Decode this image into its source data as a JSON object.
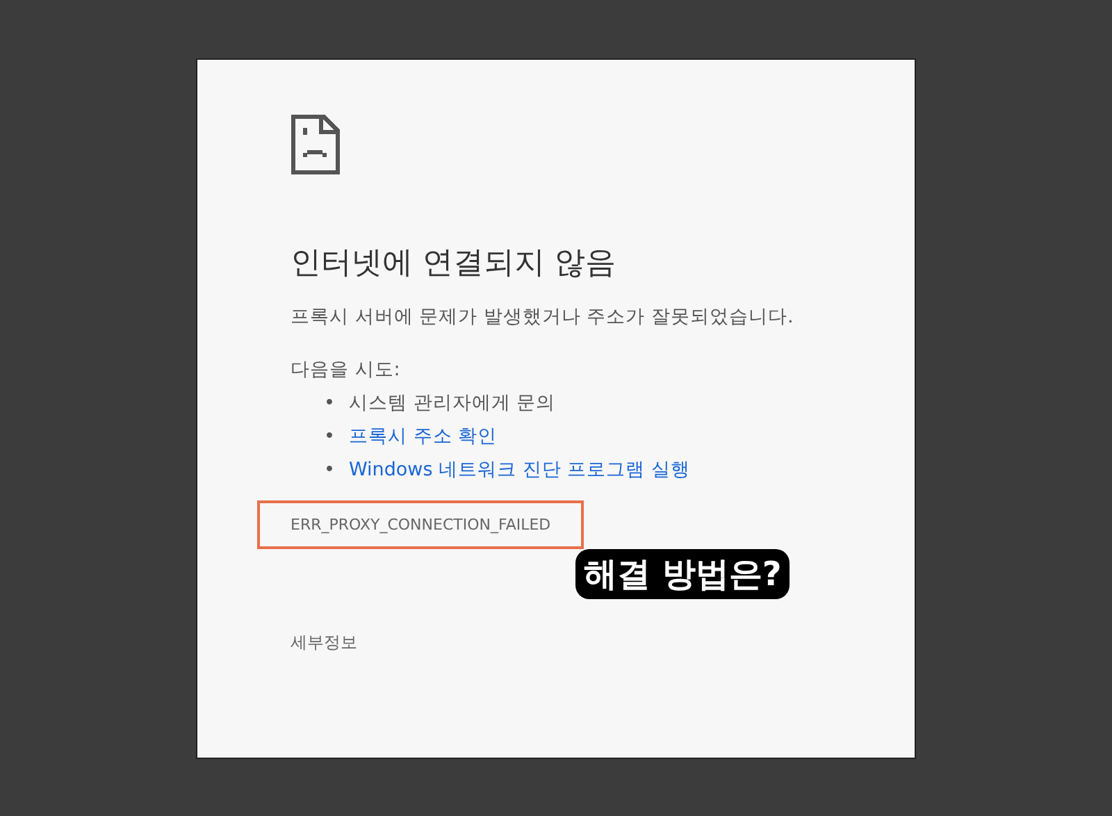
{
  "error_page": {
    "title": "인터넷에 연결되지 않음",
    "message": "프록시 서버에 문제가 발생했거나 주소가 잘못되었습니다.",
    "suggestions_heading": "다음을 시도:",
    "suggestions": [
      {
        "kind": "text",
        "bullet": "•",
        "text": "시스템 관리자에게 문의"
      },
      {
        "kind": "link",
        "bullet": "•",
        "text": "프록시 주소 확인"
      },
      {
        "kind": "link",
        "bullet": "•",
        "text": "Windows 네트워크 진단 프로그램 실행"
      }
    ],
    "error_code": {
      "text": "ERR_PROXY_CONNECTION_FAILED",
      "highlighted": true
    },
    "details_button": "세부정보"
  },
  "annotation": {
    "text": "해결 방법은?"
  }
}
